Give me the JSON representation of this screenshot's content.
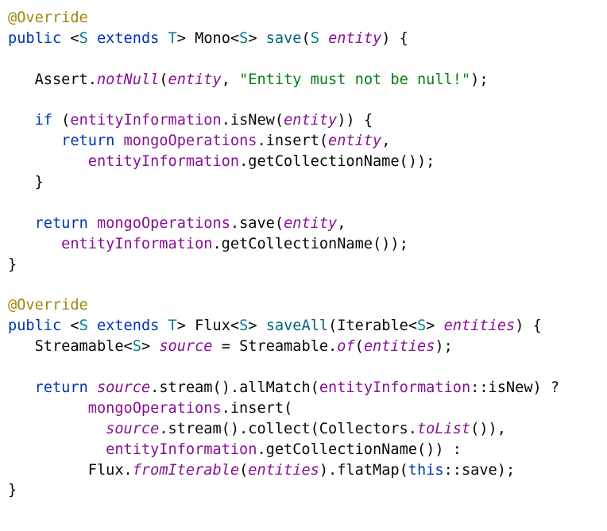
{
  "editor": {
    "lines": [
      [
        {
          "t": "@Override",
          "k": "annotation"
        }
      ],
      [
        {
          "t": "public",
          "k": "keyword"
        },
        {
          "t": " <",
          "k": "plain"
        },
        {
          "t": "S",
          "k": "type"
        },
        {
          "t": " ",
          "k": "plain"
        },
        {
          "t": "extends",
          "k": "keyword"
        },
        {
          "t": " ",
          "k": "plain"
        },
        {
          "t": "T",
          "k": "type"
        },
        {
          "t": "> Mono<",
          "k": "plain"
        },
        {
          "t": "S",
          "k": "type"
        },
        {
          "t": "> ",
          "k": "plain"
        },
        {
          "t": "save",
          "k": "method"
        },
        {
          "t": "(",
          "k": "plain"
        },
        {
          "t": "S",
          "k": "type"
        },
        {
          "t": " ",
          "k": "plain"
        },
        {
          "t": "entity",
          "k": "param"
        },
        {
          "t": ") {",
          "k": "plain"
        }
      ],
      [],
      [
        {
          "t": "   Assert.",
          "k": "plain"
        },
        {
          "t": "notNull",
          "k": "static"
        },
        {
          "t": "(",
          "k": "plain"
        },
        {
          "t": "entity",
          "k": "param"
        },
        {
          "t": ", ",
          "k": "plain"
        },
        {
          "t": "\"Entity must not be null!\"",
          "k": "string"
        },
        {
          "t": ");",
          "k": "plain"
        }
      ],
      [],
      [
        {
          "t": "   ",
          "k": "plain"
        },
        {
          "t": "if",
          "k": "keyword"
        },
        {
          "t": " (",
          "k": "plain"
        },
        {
          "t": "entityInformation",
          "k": "field"
        },
        {
          "t": ".isNew(",
          "k": "plain"
        },
        {
          "t": "entity",
          "k": "param"
        },
        {
          "t": ")) {",
          "k": "plain"
        }
      ],
      [
        {
          "t": "      ",
          "k": "plain"
        },
        {
          "t": "return",
          "k": "keyword"
        },
        {
          "t": " ",
          "k": "plain"
        },
        {
          "t": "mongoOperations",
          "k": "field"
        },
        {
          "t": ".insert(",
          "k": "plain"
        },
        {
          "t": "entity",
          "k": "param"
        },
        {
          "t": ",",
          "k": "plain"
        }
      ],
      [
        {
          "t": "         ",
          "k": "plain"
        },
        {
          "t": "entityInformation",
          "k": "field"
        },
        {
          "t": ".getCollectionName());",
          "k": "plain"
        }
      ],
      [
        {
          "t": "   }",
          "k": "plain"
        }
      ],
      [],
      [
        {
          "t": "   ",
          "k": "plain"
        },
        {
          "t": "return",
          "k": "keyword"
        },
        {
          "t": " ",
          "k": "plain"
        },
        {
          "t": "mongoOperations",
          "k": "field"
        },
        {
          "t": ".save(",
          "k": "plain"
        },
        {
          "t": "entity",
          "k": "param"
        },
        {
          "t": ",",
          "k": "plain"
        }
      ],
      [
        {
          "t": "      ",
          "k": "plain"
        },
        {
          "t": "entityInformation",
          "k": "field"
        },
        {
          "t": ".getCollectionName());",
          "k": "plain"
        }
      ],
      [
        {
          "t": "}",
          "k": "plain"
        }
      ],
      [],
      [
        {
          "t": "@Override",
          "k": "annotation"
        }
      ],
      [
        {
          "t": "public",
          "k": "keyword"
        },
        {
          "t": " <",
          "k": "plain"
        },
        {
          "t": "S",
          "k": "type"
        },
        {
          "t": " ",
          "k": "plain"
        },
        {
          "t": "extends",
          "k": "keyword"
        },
        {
          "t": " ",
          "k": "plain"
        },
        {
          "t": "T",
          "k": "type"
        },
        {
          "t": "> Flux<",
          "k": "plain"
        },
        {
          "t": "S",
          "k": "type"
        },
        {
          "t": "> ",
          "k": "plain"
        },
        {
          "t": "saveAll",
          "k": "method"
        },
        {
          "t": "(Iterable<",
          "k": "plain"
        },
        {
          "t": "S",
          "k": "type"
        },
        {
          "t": "> ",
          "k": "plain"
        },
        {
          "t": "entities",
          "k": "param"
        },
        {
          "t": ") {",
          "k": "plain"
        }
      ],
      [
        {
          "t": "   Streamable<",
          "k": "plain"
        },
        {
          "t": "S",
          "k": "type"
        },
        {
          "t": "> ",
          "k": "plain"
        },
        {
          "t": "source",
          "k": "local"
        },
        {
          "t": " = Streamable.",
          "k": "plain"
        },
        {
          "t": "of",
          "k": "static"
        },
        {
          "t": "(",
          "k": "plain"
        },
        {
          "t": "entities",
          "k": "param"
        },
        {
          "t": ");",
          "k": "plain"
        }
      ],
      [],
      [
        {
          "t": "   ",
          "k": "plain"
        },
        {
          "t": "return",
          "k": "keyword"
        },
        {
          "t": " ",
          "k": "plain"
        },
        {
          "t": "source",
          "k": "local"
        },
        {
          "t": ".stream().allMatch(",
          "k": "plain"
        },
        {
          "t": "entityInformation",
          "k": "field"
        },
        {
          "t": "::isNew) ?",
          "k": "plain"
        }
      ],
      [
        {
          "t": "         ",
          "k": "plain"
        },
        {
          "t": "mongoOperations",
          "k": "field"
        },
        {
          "t": ".insert(",
          "k": "plain"
        }
      ],
      [
        {
          "t": "           ",
          "k": "plain"
        },
        {
          "t": "source",
          "k": "local"
        },
        {
          "t": ".stream().collect(Collectors.",
          "k": "plain"
        },
        {
          "t": "toList",
          "k": "static"
        },
        {
          "t": "()),",
          "k": "plain"
        }
      ],
      [
        {
          "t": "           ",
          "k": "plain"
        },
        {
          "t": "entityInformation",
          "k": "field"
        },
        {
          "t": ".getCollectionName()) :",
          "k": "plain"
        }
      ],
      [
        {
          "t": "         Flux.",
          "k": "plain"
        },
        {
          "t": "fromIterable",
          "k": "static"
        },
        {
          "t": "(",
          "k": "plain"
        },
        {
          "t": "entities",
          "k": "param"
        },
        {
          "t": ").flatMap(",
          "k": "plain"
        },
        {
          "t": "this",
          "k": "keyword"
        },
        {
          "t": "::save);",
          "k": "plain"
        }
      ],
      [
        {
          "t": "}",
          "k": "plain"
        }
      ]
    ]
  }
}
